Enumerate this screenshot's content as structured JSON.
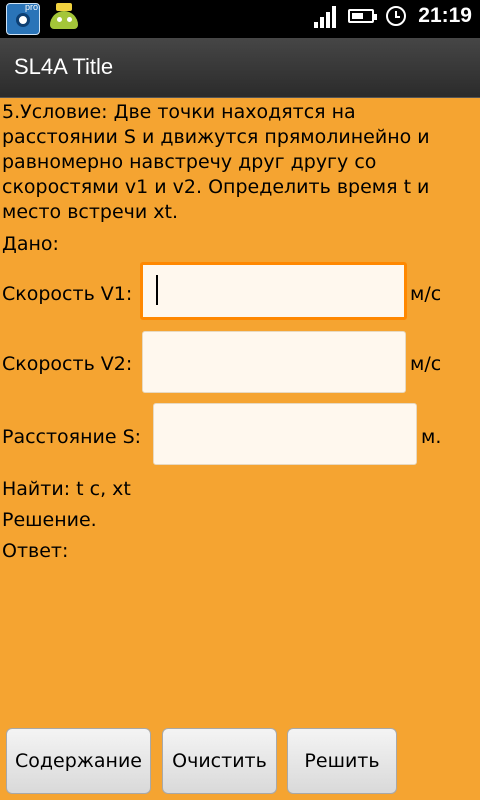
{
  "status_bar": {
    "time": "21:19",
    "battery_level": 0.55,
    "notification_icons": [
      "camera-pro-icon",
      "android-crown-icon"
    ],
    "pro_badge": "pro"
  },
  "titlebar": {
    "title": "SL4A Title"
  },
  "main": {
    "condition": "5.Условие: Две точки находятся на расстоянии S и движутся  прямолинейно и равномерно навстречу друг другу со скоростями v1 и v2. Определить время t и место встречи xt.",
    "given_label": "Дано:",
    "fields": [
      {
        "label": "Скорость V1:",
        "unit": "м/с",
        "value": "",
        "focused": true
      },
      {
        "label": "Скорость V2:",
        "unit": "м/с",
        "value": "",
        "focused": false
      },
      {
        "label": "Расстояние S:",
        "unit": "м.",
        "value": "",
        "focused": false
      }
    ],
    "find_label": "Найти: t с, xt",
    "solution_label": "Решение.",
    "answer_label": "Ответ:"
  },
  "buttons": {
    "contents": "Содержание",
    "clear": "Очистить",
    "solve": "Решить"
  },
  "colors": {
    "background": "#f5a431",
    "focus": "#ff8800"
  }
}
